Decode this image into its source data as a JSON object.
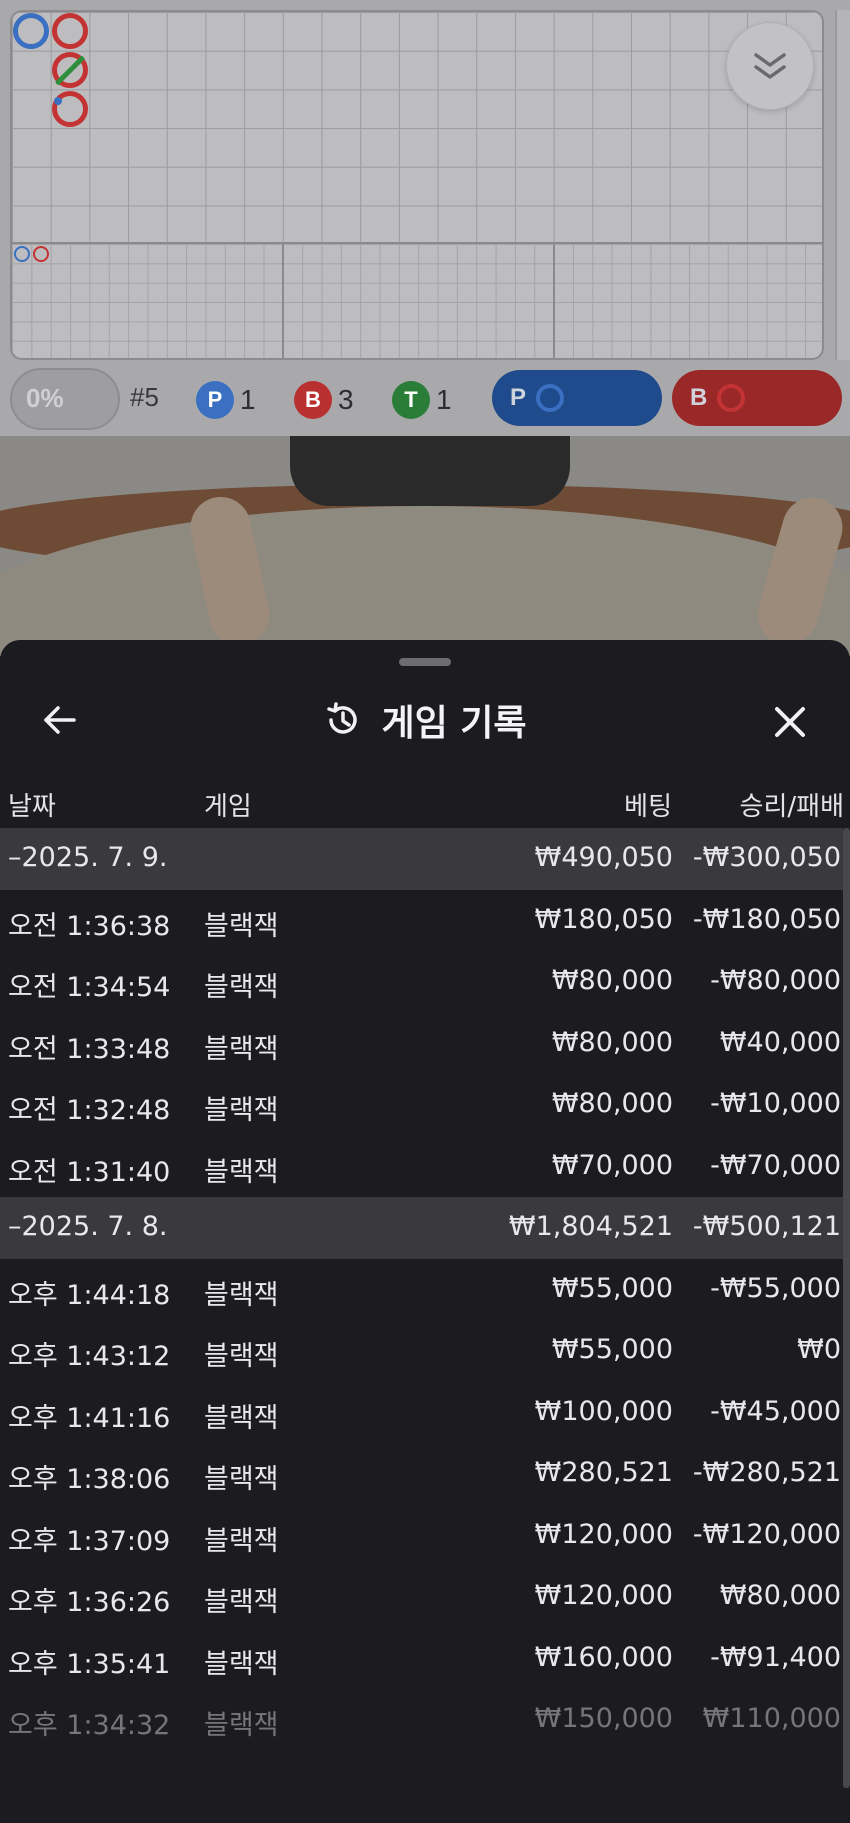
{
  "stats": {
    "percent": "0%",
    "shoe": "#5",
    "player_chip": "P",
    "player_count": "1",
    "banker_chip": "B",
    "banker_count": "3",
    "tie_chip": "T",
    "tie_count": "1",
    "player_predict": "P",
    "banker_predict": "B"
  },
  "colors": {
    "player": "#2f6bd0",
    "banker": "#c62a2a",
    "tie": "#2a8a3a"
  },
  "sheet": {
    "title": "게임 기록",
    "icons": [
      "back-arrow-icon",
      "history-icon",
      "close-icon",
      "chevron-down-icon"
    ]
  },
  "columns": {
    "date": "날짜",
    "game": "게임",
    "bet": "베팅",
    "result": "승리/패배"
  },
  "groups": [
    {
      "date": "–2025. 7. 9.",
      "bet": "₩490,050",
      "result": "-₩300,050",
      "rows": [
        {
          "time": "오전 1:36:38",
          "game": "블랙잭",
          "bet": "₩180,050",
          "result": "-₩180,050"
        },
        {
          "time": "오전 1:34:54",
          "game": "블랙잭",
          "bet": "₩80,000",
          "result": "-₩80,000"
        },
        {
          "time": "오전 1:33:48",
          "game": "블랙잭",
          "bet": "₩80,000",
          "result": "₩40,000"
        },
        {
          "time": "오전 1:32:48",
          "game": "블랙잭",
          "bet": "₩80,000",
          "result": "-₩10,000"
        },
        {
          "time": "오전 1:31:40",
          "game": "블랙잭",
          "bet": "₩70,000",
          "result": "-₩70,000"
        }
      ]
    },
    {
      "date": "–2025. 7. 8.",
      "bet": "₩1,804,521",
      "result": "-₩500,121",
      "rows": [
        {
          "time": "오후 1:44:18",
          "game": "블랙잭",
          "bet": "₩55,000",
          "result": "-₩55,000"
        },
        {
          "time": "오후 1:43:12",
          "game": "블랙잭",
          "bet": "₩55,000",
          "result": "₩0"
        },
        {
          "time": "오후 1:41:16",
          "game": "블랙잭",
          "bet": "₩100,000",
          "result": "-₩45,000"
        },
        {
          "time": "오후 1:38:06",
          "game": "블랙잭",
          "bet": "₩280,521",
          "result": "-₩280,521"
        },
        {
          "time": "오후 1:37:09",
          "game": "블랙잭",
          "bet": "₩120,000",
          "result": "-₩120,000"
        },
        {
          "time": "오후 1:36:26",
          "game": "블랙잭",
          "bet": "₩120,000",
          "result": "₩80,000"
        },
        {
          "time": "오후 1:35:41",
          "game": "블랙잭",
          "bet": "₩160,000",
          "result": "-₩91,400"
        },
        {
          "time": "오후 1:34:32",
          "game": "블랙잭",
          "bet": "₩150,000",
          "result": "₩110,000"
        }
      ]
    }
  ]
}
